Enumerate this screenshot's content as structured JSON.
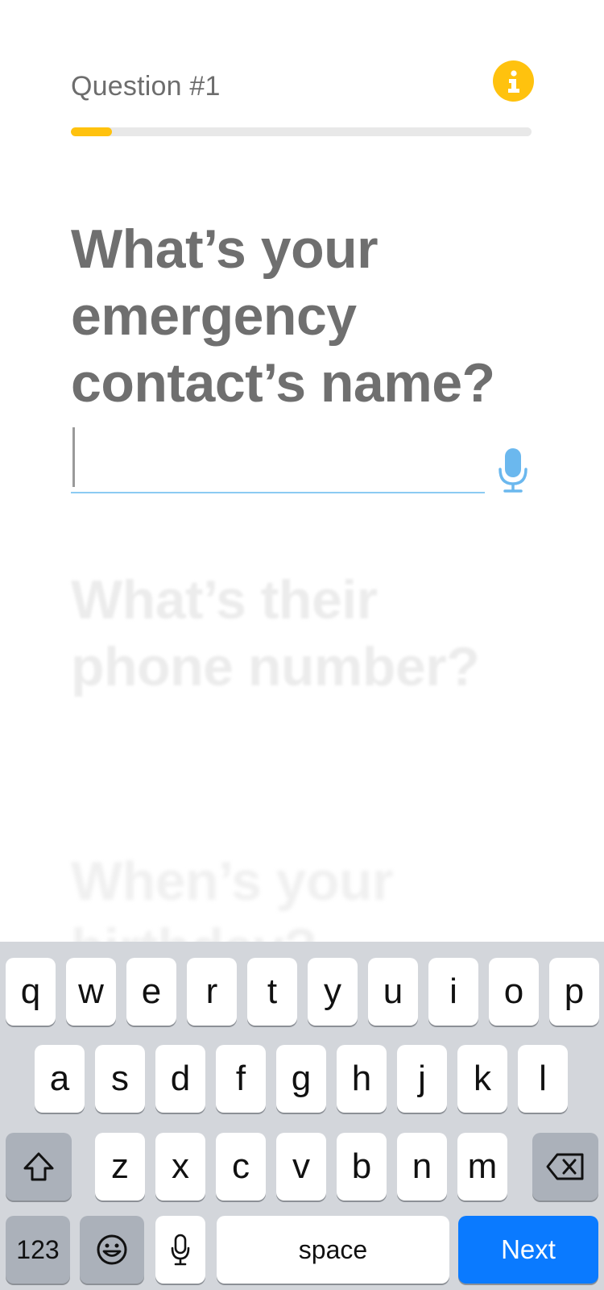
{
  "header": {
    "question_number": "Question #1",
    "info_icon": "info-icon",
    "progress": 0.09
  },
  "questions": {
    "current": "What’s your emergency contact’s name?",
    "next": "What’s their phone number?",
    "later": "When’s your birthday?"
  },
  "answer": {
    "value": "",
    "mic_icon": "microphone-icon"
  },
  "colors": {
    "accent_yellow": "#ffc20e",
    "accent_blue": "#0a7aff",
    "field_underline": "#8ccbf2"
  },
  "keyboard": {
    "row1": [
      "q",
      "w",
      "e",
      "r",
      "t",
      "y",
      "u",
      "i",
      "o",
      "p"
    ],
    "row2": [
      "a",
      "s",
      "d",
      "f",
      "g",
      "h",
      "j",
      "k",
      "l"
    ],
    "row3": [
      "z",
      "x",
      "c",
      "v",
      "b",
      "n",
      "m"
    ],
    "numbers_key": "123",
    "space_key": "space",
    "return_key": "Next",
    "shift_icon": "shift-icon",
    "delete_icon": "delete-icon",
    "emoji_icon": "emoji-icon",
    "dictation_icon": "microphone-icon"
  }
}
